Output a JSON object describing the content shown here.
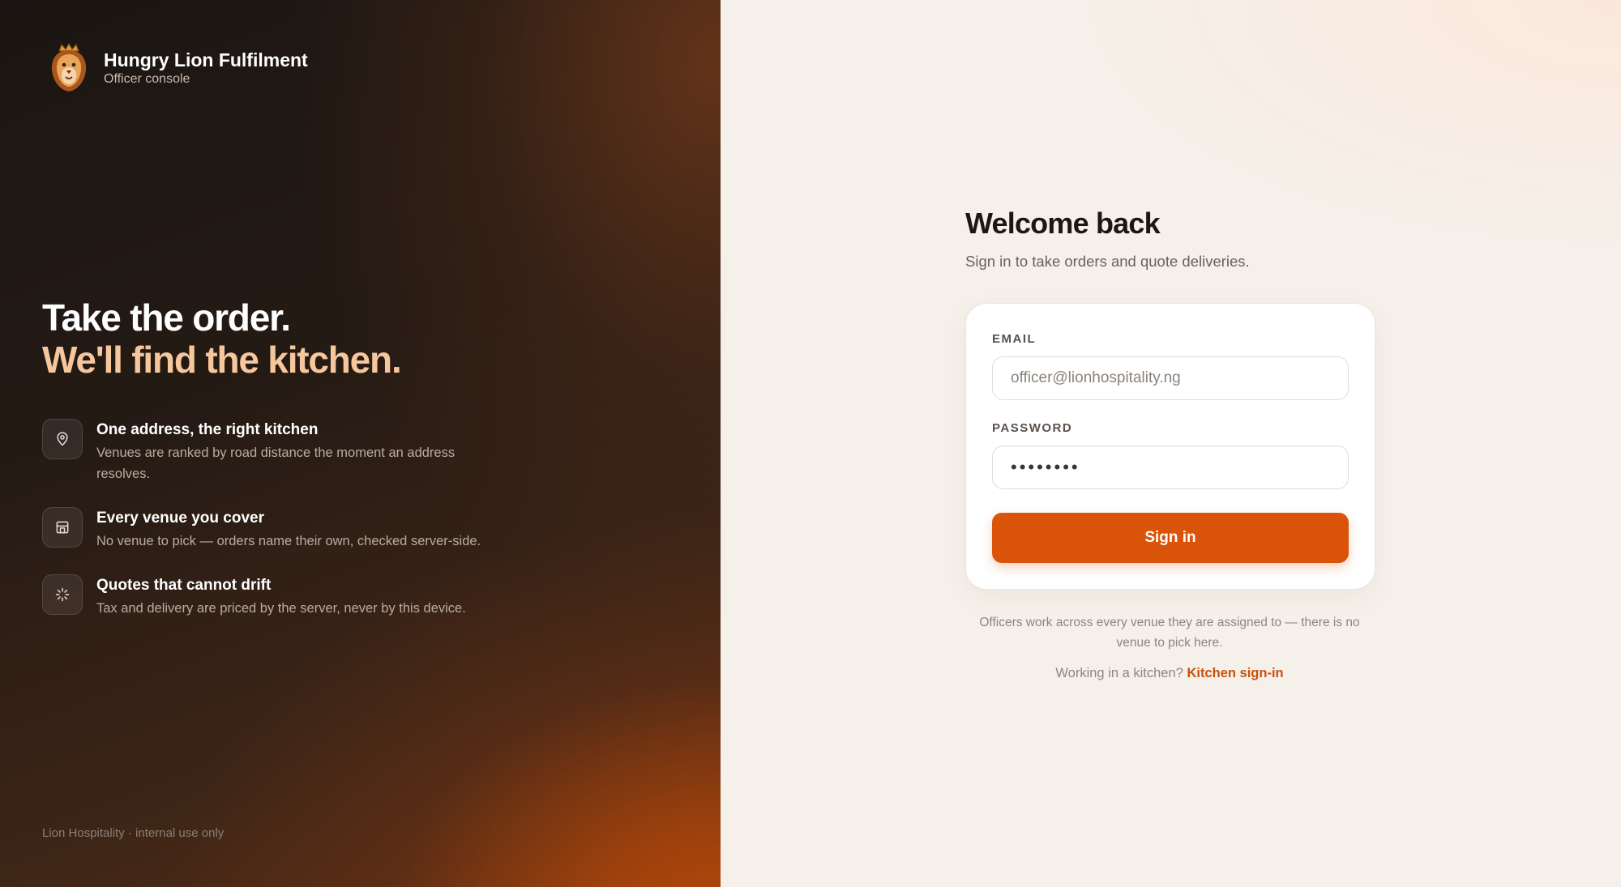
{
  "brand": {
    "name": "Hungry Lion Fulfilment",
    "subtitle": "Officer console"
  },
  "hero": {
    "line1": "Take the order.",
    "line2": "We'll find the kitchen."
  },
  "features": [
    {
      "icon": "map-pin-icon",
      "title": "One address, the right kitchen",
      "description": "Venues are ranked by road distance the moment an address resolves."
    },
    {
      "icon": "storefront-icon",
      "title": "Every venue you cover",
      "description": "No venue to pick — orders name their own, checked server-side."
    },
    {
      "icon": "loader-icon",
      "title": "Quotes that cannot drift",
      "description": "Tax and delivery are priced by the server, never by this device."
    }
  ],
  "footer_note": "Lion Hospitality · internal use only",
  "login": {
    "title": "Welcome back",
    "subtitle": "Sign in to take orders and quote deliveries.",
    "email_label": "EMAIL",
    "email_placeholder": "officer@lionhospitality.ng",
    "password_label": "PASSWORD",
    "password_value": "••••••••",
    "signin_label": "Sign in",
    "note": "Officers work across every venue they are assigned to — there is no venue to pick here.",
    "kitchen_prompt": "Working in a kitchen?",
    "kitchen_link": "Kitchen sign-in"
  },
  "colors": {
    "accent": "#d95409",
    "hero_highlight": "#f6c79c",
    "left_panel_dark": "#1b1613",
    "right_panel_bg": "#f5f0ea"
  }
}
